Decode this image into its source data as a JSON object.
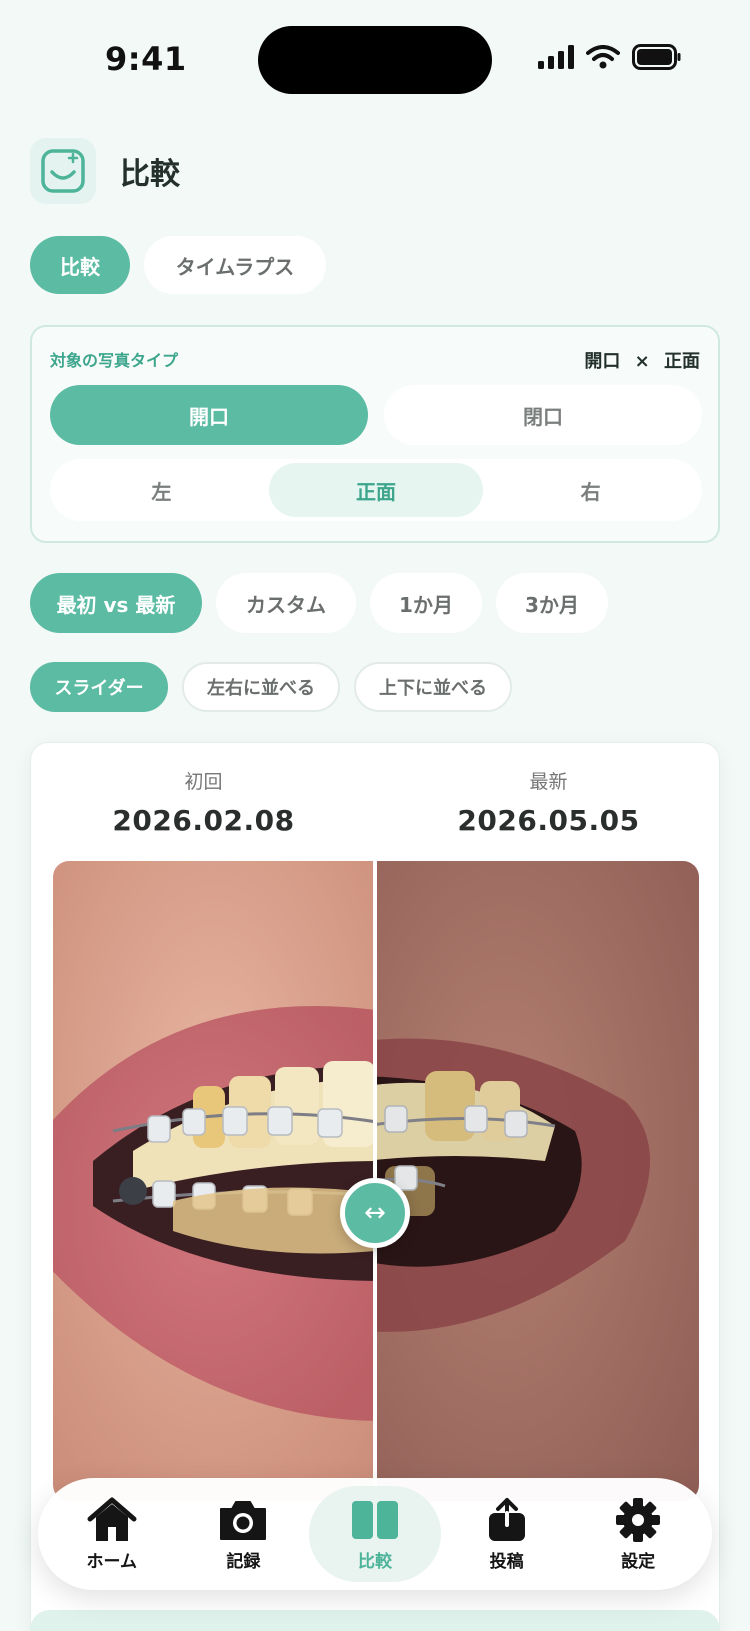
{
  "status_bar": {
    "time": "9:41"
  },
  "header": {
    "title": "比較",
    "app_icon": "smile-logo-icon"
  },
  "mode_tabs": [
    {
      "label": "比較",
      "active": true
    },
    {
      "label": "タイムラプス",
      "active": false
    }
  ],
  "photo_type": {
    "label": "対象の写真タイプ",
    "summary_mouth": "開口",
    "summary_sep": "×",
    "summary_angle": "正面",
    "mouth_options": [
      {
        "label": "開口",
        "active": true
      },
      {
        "label": "閉口",
        "active": false
      }
    ],
    "angle_options": [
      {
        "label": "左",
        "active": false
      },
      {
        "label": "正面",
        "active": true
      },
      {
        "label": "右",
        "active": false
      }
    ]
  },
  "range_tabs": [
    {
      "label": "最初 vs 最新",
      "active": true
    },
    {
      "label": "カスタム",
      "active": false
    },
    {
      "label": "1か月",
      "active": false
    },
    {
      "label": "3か月",
      "active": false
    }
  ],
  "view_tabs": [
    {
      "label": "スライダー",
      "active": true
    },
    {
      "label": "左右に並べる",
      "active": false
    },
    {
      "label": "上下に並べる",
      "active": false
    }
  ],
  "comparison": {
    "left_caption": "初回",
    "left_date": "2026.02.08",
    "right_caption": "最新",
    "right_date": "2026.05.05",
    "slider_position": 0.5,
    "slider_icon": "left-right-arrow-icon"
  },
  "tab_bar": [
    {
      "label": "ホーム",
      "icon": "home-icon",
      "active": false
    },
    {
      "label": "記録",
      "icon": "camera-icon",
      "active": false
    },
    {
      "label": "比較",
      "icon": "compare-icon",
      "active": true
    },
    {
      "label": "投稿",
      "icon": "share-icon",
      "active": false
    },
    {
      "label": "設定",
      "icon": "gear-icon",
      "active": false
    }
  ],
  "colors": {
    "accent": "#5cbba3",
    "background": "#f2f9f7",
    "accent_light": "#e6f5f0"
  }
}
